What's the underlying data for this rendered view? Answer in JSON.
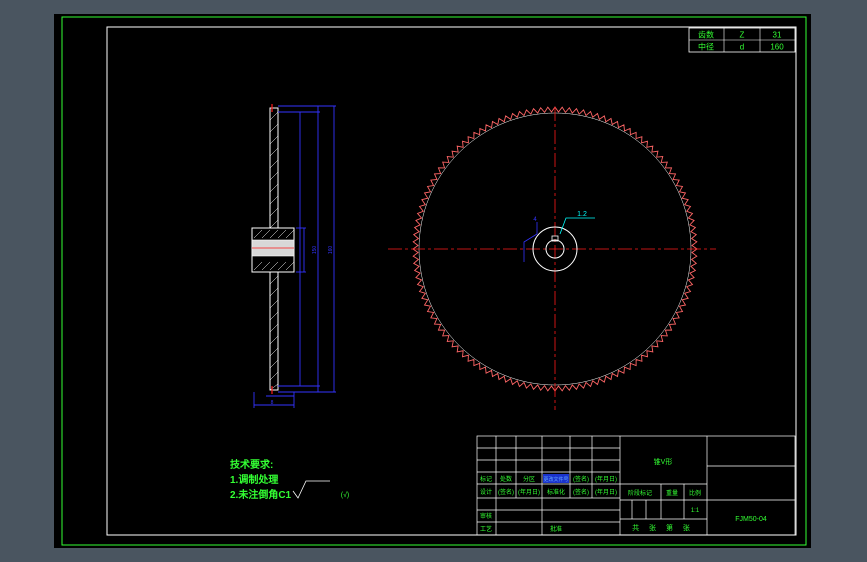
{
  "colors": {
    "background": "#4a5560",
    "canvas": "#000000",
    "frame": "#33ff33",
    "geometry": "#ffffff",
    "dimension": "#3333ff",
    "centerline": "#ff1a1a",
    "annotation": "#00ffff",
    "text": "#33ff33",
    "highlight": "#3366ff"
  },
  "spec_table": {
    "rows": [
      {
        "label": "齿数",
        "symbol": "Z",
        "value": "31"
      },
      {
        "label": "中径",
        "symbol": "d",
        "value": "160"
      }
    ]
  },
  "side_view": {
    "dimension_labels": [
      "150",
      "160"
    ],
    "bottom_label": "8"
  },
  "front_view": {
    "chamfer_callout": "1.2",
    "keyway_label": "4"
  },
  "tech_notes": {
    "title": "技术要求:",
    "lines": [
      "1.调制处理",
      "2.未注倒角C1"
    ],
    "roughness_note": "(√)"
  },
  "title_block": {
    "part_name": "锥V形",
    "drawing_number": "FJM50-04",
    "scale_label": "比例",
    "scale_value": "1:1",
    "weight_label": "重量",
    "stage_label": "阶段标记",
    "sheet_note": "共 张 第 张",
    "row1": [
      "标记",
      "处数",
      "分区",
      "更改文件号",
      "(签名)",
      "(年月日)"
    ],
    "row2": [
      "设计",
      "(签名)",
      "(年月日)",
      "标准化",
      "(签名)",
      "(年月日)"
    ],
    "review": "审核",
    "process": "工艺",
    "approve": "批准"
  }
}
